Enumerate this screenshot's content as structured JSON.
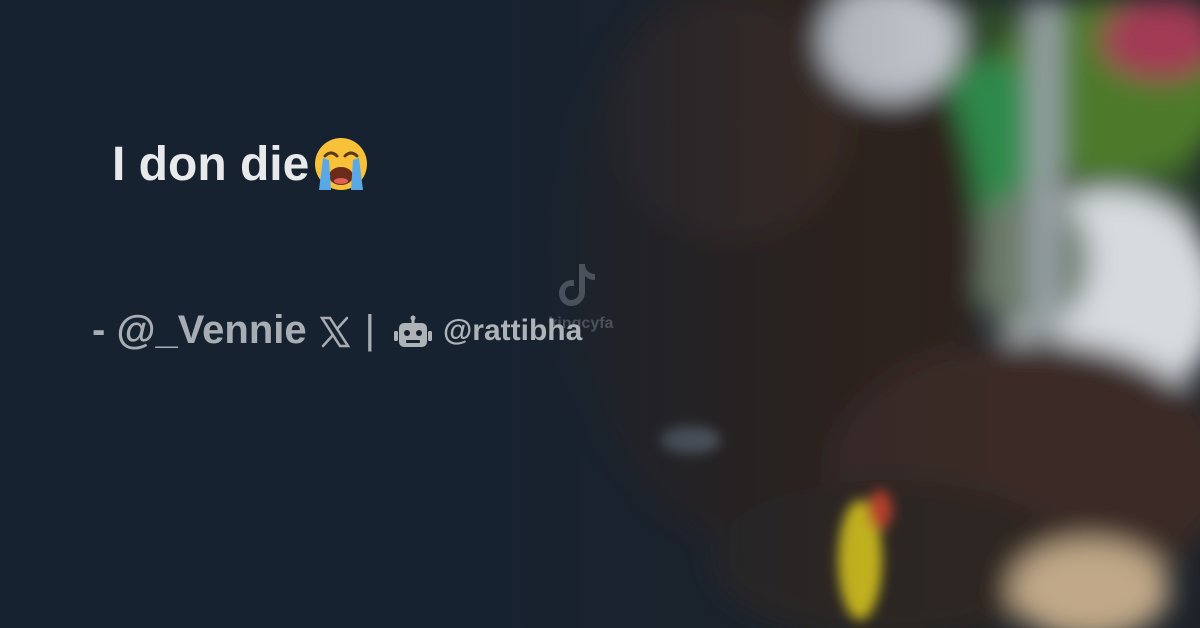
{
  "tweet": {
    "text": "I don die",
    "emoji": "loudly-crying-face-icon"
  },
  "byline": {
    "prefix": "- ",
    "author_handle": "@_Vennie",
    "platform_icon": "x-logo-icon",
    "separator": "|",
    "bot_icon": "robot-icon",
    "bot_handle": "@rattibha"
  },
  "watermark": {
    "icon": "tiktok-logo-icon",
    "text": "kingcyfa"
  },
  "colors": {
    "background": "#172230",
    "tweet_text": "#e8e9ea",
    "byline_text": "#a8adb3"
  }
}
